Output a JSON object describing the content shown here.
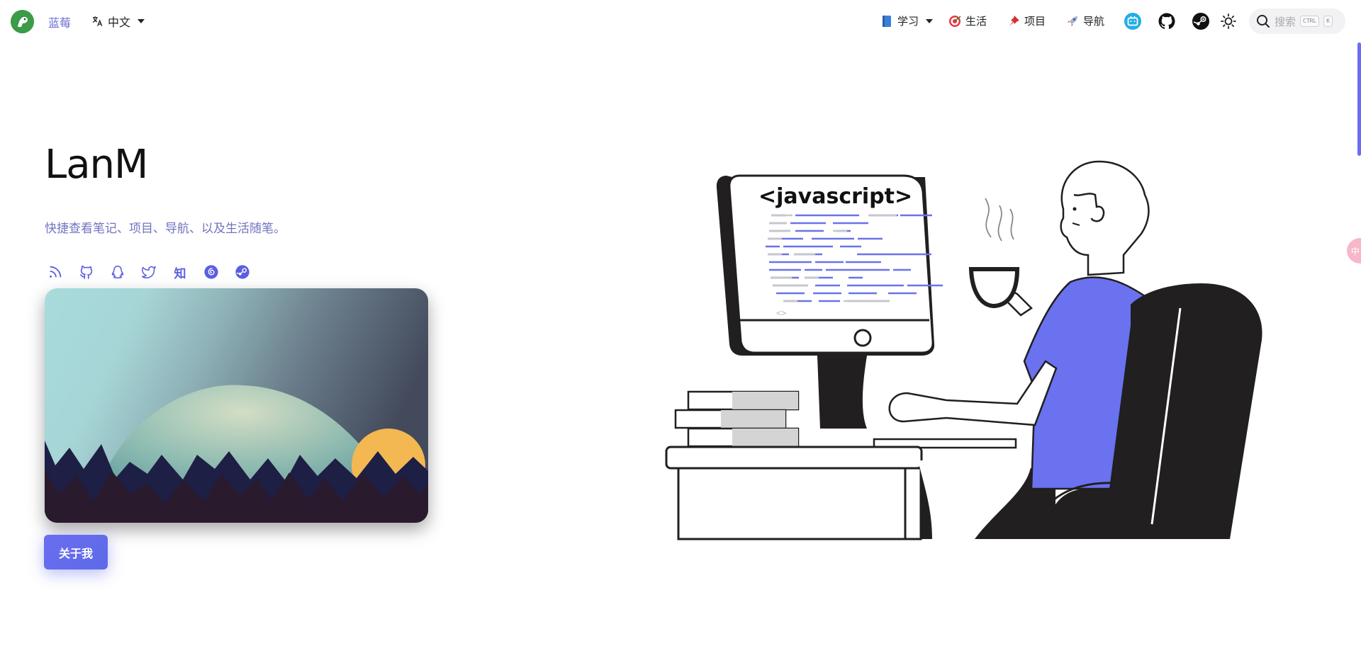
{
  "navbar": {
    "site_name": "蓝莓",
    "language": "中文",
    "links": [
      {
        "label": "学习",
        "icon": "book-icon",
        "has_dropdown": true
      },
      {
        "label": "生活",
        "icon": "target-icon"
      },
      {
        "label": "项目",
        "icon": "pin-icon"
      },
      {
        "label": "导航",
        "icon": "rocket-icon"
      }
    ],
    "icons": [
      "bilibili-icon",
      "github-icon",
      "steam-icon",
      "theme-toggle-icon"
    ],
    "search": {
      "placeholder": "搜索",
      "kbd1": "CTRL",
      "kbd2": "K"
    }
  },
  "hero": {
    "title": "LanM",
    "description": "快捷查看笔记、项目、导航、以及生活随笔。",
    "social_icons": [
      "rss-icon",
      "github-icon",
      "qq-icon",
      "twitter-icon",
      "zhihu-icon",
      "netease-music-icon",
      "steam-icon"
    ],
    "zhihu_glyph": "知",
    "about_button": "关于我"
  },
  "illustration": {
    "code_label": "<javascript>",
    "footer_glyph": "<>"
  },
  "side_bubble": "中",
  "colors": {
    "accent": "#6b6cf0",
    "link": "#6b6bd8",
    "text": "#222222"
  }
}
